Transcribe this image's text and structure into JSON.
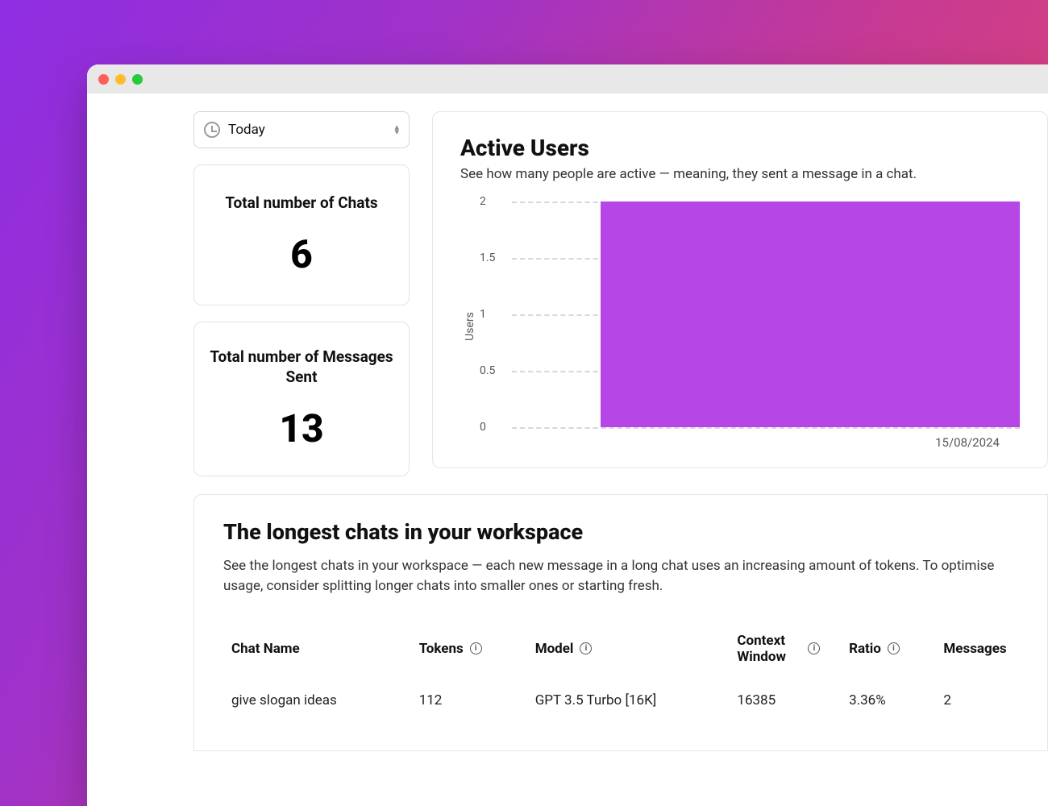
{
  "timeRange": {
    "label": "Today"
  },
  "stats": {
    "chats": {
      "title": "Total number of Chats",
      "value": "6"
    },
    "messages": {
      "title": "Total number of Messages Sent",
      "value": "13"
    }
  },
  "activeUsers": {
    "title": "Active Users",
    "subtitle": "See how many people are active — meaning, they sent a message in a chat.",
    "ylabel": "Users"
  },
  "chart_data": {
    "type": "bar",
    "categories": [
      "15/08/2024"
    ],
    "values": [
      2
    ],
    "title": "Active Users",
    "xlabel": "",
    "ylabel": "Users",
    "ylim": [
      0,
      2
    ],
    "yticks": [
      0,
      0.5,
      1,
      1.5,
      2
    ],
    "bar_color": "#b33ce5"
  },
  "longestChats": {
    "title": "The longest chats in your workspace",
    "subtitle": "See the longest chats in your workspace — each new message in a long chat uses an increasing amount of tokens. To optimise usage, consider splitting longer chats into smaller ones or starting fresh.",
    "columns": {
      "chatName": "Chat Name",
      "tokens": "Tokens",
      "model": "Model",
      "contextWindow": "Context Window",
      "ratio": "Ratio",
      "messages": "Messages"
    },
    "rows": [
      {
        "chatName": "give slogan ideas",
        "tokens": "112",
        "model": "GPT 3.5 Turbo [16K]",
        "contextWindow": "16385",
        "ratio": "3.36%",
        "messages": "2"
      }
    ]
  }
}
